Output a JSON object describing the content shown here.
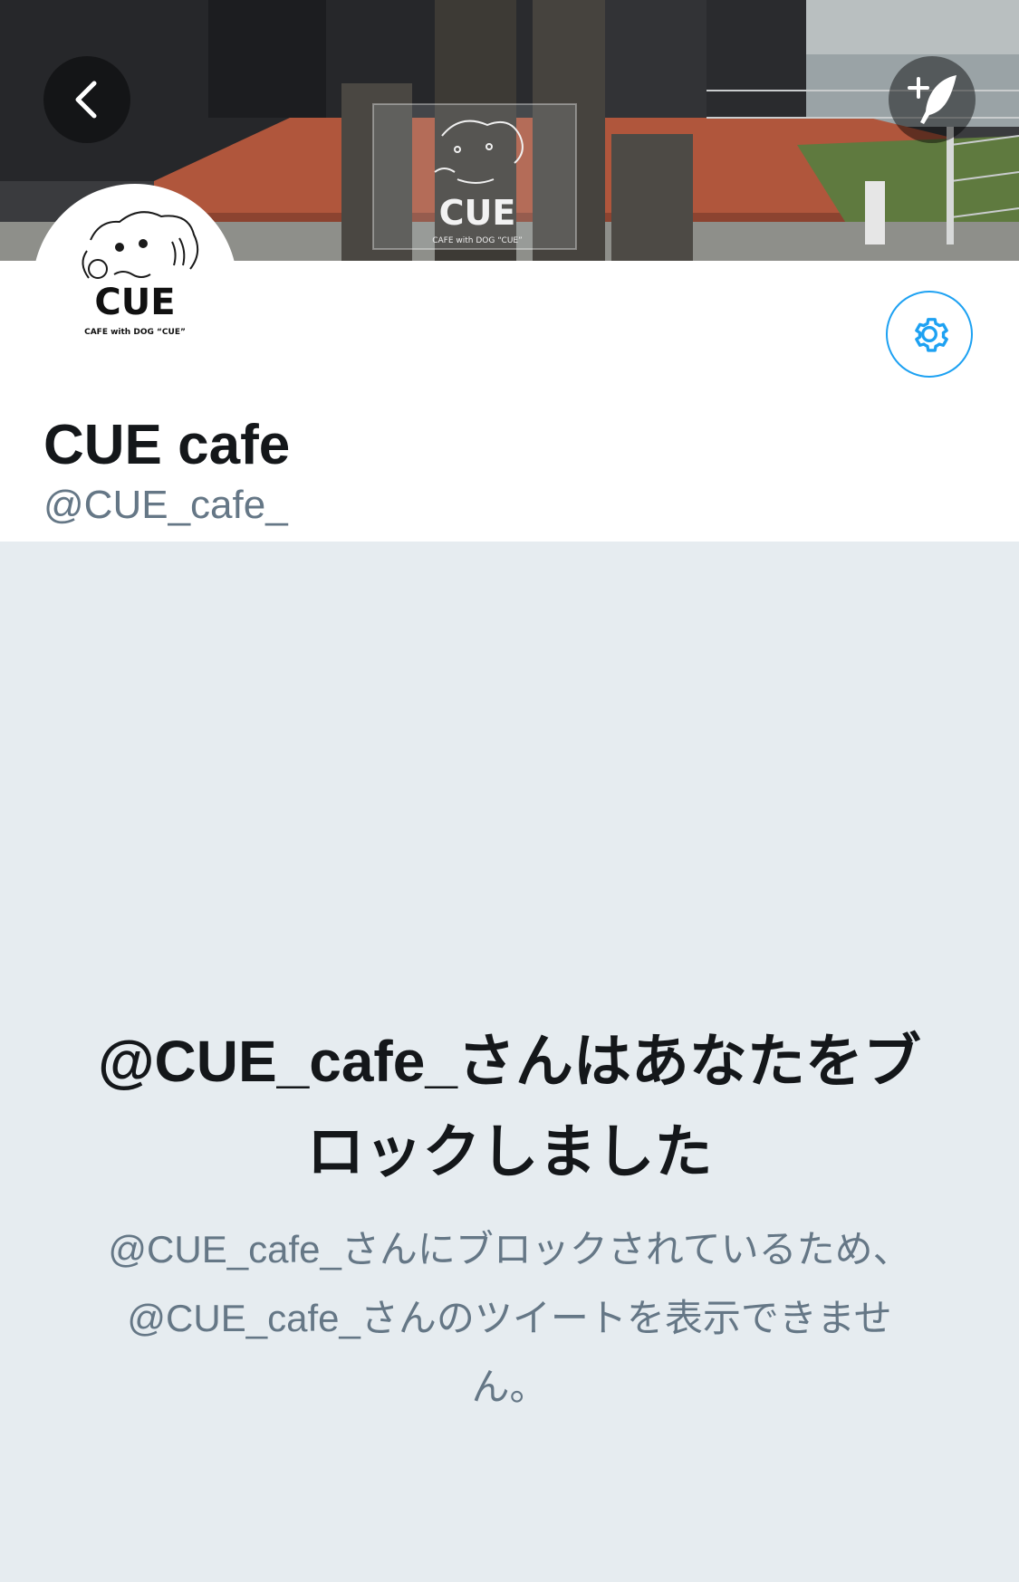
{
  "header": {
    "back_icon": "chevron-left-icon",
    "compose_icon": "compose-tweet-icon"
  },
  "banner": {
    "sign_logo_text": "CUE",
    "sign_sub_text": "CAFE with DOG “CUE”"
  },
  "profile": {
    "avatar_logo_text": "CUE",
    "avatar_sub_text": "CAFE with DOG “CUE”",
    "settings_icon": "gear-icon",
    "display_name": "CUE cafe",
    "handle": "@CUE_cafe_"
  },
  "blocked": {
    "title": "@CUE_cafe_さんはあなたをブロックしました",
    "description": "@CUE_cafe_さんにブロックされているため、@CUE_cafe_さんのツイートを表示できません。"
  },
  "colors": {
    "accent": "#1da1f2",
    "background": "#e6ecf0",
    "text_primary": "#14171a",
    "text_secondary": "#657786"
  }
}
